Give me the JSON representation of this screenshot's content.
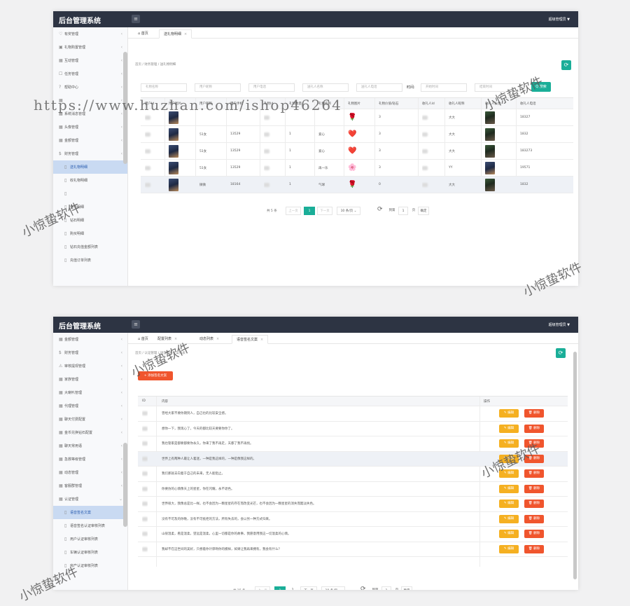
{
  "watermark": {
    "url": "https://www.huzhan.com/ishop46264",
    "text": "小惊蛰软件"
  },
  "top": {
    "brand": "后台管理系统",
    "admin": "超级管理员 ▼",
    "sidebar": [
      {
        "label": "有奖管理",
        "icon": "heart-icon"
      },
      {
        "label": "礼物购置管理",
        "icon": "gift-icon"
      },
      {
        "label": "互动管理",
        "icon": "grid-icon"
      },
      {
        "label": "任务管理",
        "icon": "task-icon"
      },
      {
        "label": "帮助中心",
        "icon": "help-icon"
      },
      {
        "label": "",
        "icon": "grid-icon"
      },
      {
        "label": "系统消息管理",
        "icon": "grid-icon"
      },
      {
        "label": "头像管理",
        "icon": "grid-icon"
      },
      {
        "label": "金额管理",
        "icon": "grid-icon"
      },
      {
        "label": "财务管理",
        "icon": "dollar-icon"
      },
      {
        "label": "送礼物明细",
        "icon": "file-icon",
        "sub": true,
        "active": true
      },
      {
        "label": "收礼物明细",
        "icon": "file-icon",
        "sub": true
      },
      {
        "label": "",
        "icon": "file-icon",
        "sub": true
      },
      {
        "label": "金币明细",
        "icon": "file-icon",
        "sub": true
      },
      {
        "label": "钻石明细",
        "icon": "file-icon",
        "sub": true
      },
      {
        "label": "购买明细",
        "icon": "file-icon",
        "sub": true
      },
      {
        "label": "钻石充值金额列表",
        "icon": "file-icon",
        "sub": true
      },
      {
        "label": "充值订单列表",
        "icon": "file-icon",
        "sub": true
      }
    ],
    "tabs": [
      "首页",
      "送礼物明细"
    ],
    "breadcrumb": "首页  /  财务管理  /  送礼物明细",
    "filters": [
      "礼物名称",
      "用户昵称",
      "用户电话",
      "送礼人名称",
      "送礼人电话"
    ],
    "time_label": "时间:",
    "start_ph": "开始时间",
    "end_ph": "结束时间",
    "search_btn": "Q 搜索",
    "columns": [
      "用户Id",
      "用户图片",
      "用户昵称",
      "用户手机",
      "礼物Id",
      "礼物数量",
      "礼物名称",
      "礼物图片",
      "礼物价值/钻石",
      "收礼人Id",
      "收礼人昵称",
      "收礼人头像",
      "收礼人电话"
    ],
    "rows": [
      {
        "nick": "",
        "phone": "",
        "qty": "",
        "gift": "",
        "emoji": "🌹",
        "value": "3",
        "rname": "大大",
        "rphone": "18327"
      },
      {
        "nick": "51女",
        "phone": "13529",
        "qty": "1",
        "gift": "爱心",
        "emoji": "❤️",
        "value": "3",
        "rname": "大大",
        "rphone": "1832"
      },
      {
        "nick": "51女",
        "phone": "13529",
        "qty": "1",
        "gift": "爱心",
        "emoji": "❤️",
        "value": "3",
        "rname": "大大",
        "rphone": "183273"
      },
      {
        "nick": "51女",
        "phone": "13529",
        "qty": "1",
        "gift": "再一乐",
        "emoji": "🌸",
        "value": "3",
        "rname": "YY",
        "rphone": "19571"
      },
      {
        "nick": "微微",
        "phone": "18164",
        "qty": "1",
        "gift": "气球",
        "emoji": "🌹",
        "value": "0",
        "rname": "大大",
        "rphone": "1832"
      }
    ],
    "pager": {
      "total": "共 5 条",
      "prev": "上一页",
      "page": "1",
      "next": "下一页",
      "size": "10 条/页 ⌄",
      "goto": "到第",
      "goto_val": "1",
      "page_unit": "页",
      "ok": "确定"
    }
  },
  "bottom": {
    "brand": "后台管理系统",
    "admin": "超级管理员 ▼",
    "sidebar": [
      {
        "label": "金额管理",
        "icon": "grid-icon"
      },
      {
        "label": "财务管理",
        "icon": "dollar-icon"
      },
      {
        "label": "审核提现管理",
        "icon": "warning-icon"
      },
      {
        "label": "家族管理",
        "icon": "grid-icon"
      },
      {
        "label": "大喇叭管理",
        "icon": "grid-icon"
      },
      {
        "label": "代理管理",
        "icon": "grid-icon"
      },
      {
        "label": "聊天付费配置",
        "icon": "grid-icon"
      },
      {
        "label": "金币兑换钻石配置",
        "icon": "grid-icon"
      },
      {
        "label": "聊天常用语",
        "icon": "grid-icon"
      },
      {
        "label": "急救等级管理",
        "icon": "grid-icon"
      },
      {
        "label": "动态管理",
        "icon": "grid-icon"
      },
      {
        "label": "客服群管理",
        "icon": "grid-icon"
      },
      {
        "label": "认证管理",
        "icon": "grid-icon",
        "open": true
      },
      {
        "label": "语音签名文案",
        "icon": "file-icon",
        "sub": true,
        "active": true
      },
      {
        "label": "语音签名认证审核列表",
        "icon": "file-icon",
        "sub": true
      },
      {
        "label": "用户认证审核列表",
        "icon": "file-icon",
        "sub": true
      },
      {
        "label": "车辆认证审核列表",
        "icon": "file-icon",
        "sub": true
      },
      {
        "label": "房产认证审核列表",
        "icon": "file-icon",
        "sub": true
      }
    ],
    "tabs": [
      "首页",
      "配置列表",
      "动态列表",
      "语音签名文案"
    ],
    "breadcrumb": "首页  /  认证管理  /  语音签名文案列表",
    "add_btn": "+ 添加签名文案",
    "columns": [
      "ID",
      "内容",
      "操作"
    ],
    "rows": [
      "曾经大家不要你期到人，自己也的比较安全感。",
      "想你一下，我现心了，今天的都比较天要要你你了。",
      "我也管家是都要都要你永久，你来了我不再走，天都了我不再找。",
      "世界上有两种人最让人着迷，一种是我这样的，一种是像我这样的。",
      "我们那就去向着于自己的未来，无人能阻止。",
      "你要仿的心情像天上的星星，你在闪耀，永不退色。",
      "世界很大，我像总是比一样。也不会因为一颗星星的存在而改变光芒，也不会因为一颗星星的消失而黯淡失色。",
      "没有不可及的你晚，没有不可抵拒的方法，所有失去的，会以另一种方式归来。",
      "山很温柔，看是温柔，望远是温柔，心里一切都是你的故事，我愿意用我这一切温柔的心情。",
      "我却不在这世间的美好，只想着你计厚吻你的模样，如果让我再来拥有，我会有什么？"
    ],
    "edit": "✎ 编辑",
    "del": "🗑 删除",
    "pager": {
      "total": "共 15 条",
      "prev": "上一页",
      "p1": "1",
      "p2": "2",
      "next": "下一页",
      "size": "10 条/页 ⌄",
      "goto": "到第",
      "goto_val": "1",
      "page_unit": "页",
      "ok": "确定"
    }
  }
}
